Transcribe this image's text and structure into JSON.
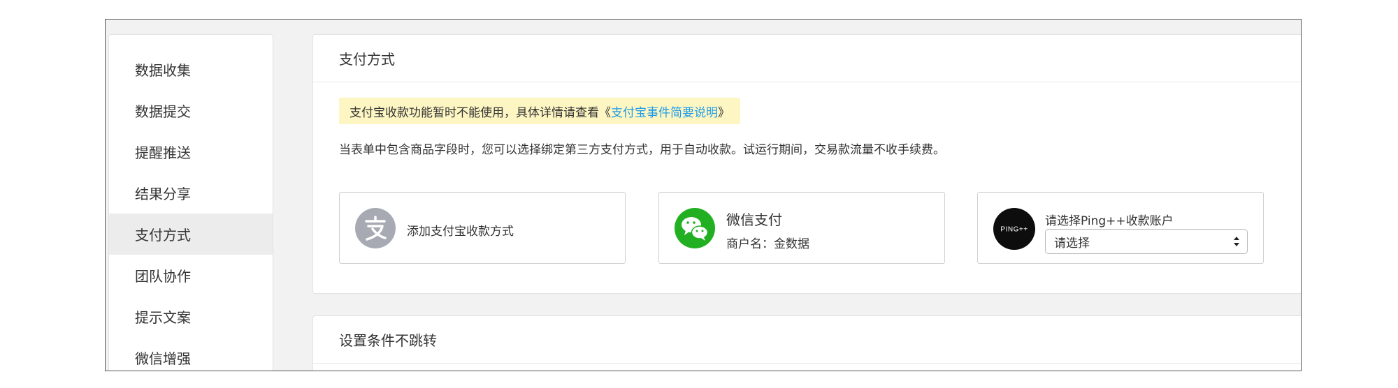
{
  "sidebar": {
    "items": [
      {
        "label": "数据收集"
      },
      {
        "label": "数据提交"
      },
      {
        "label": "提醒推送"
      },
      {
        "label": "结果分享"
      },
      {
        "label": "支付方式"
      },
      {
        "label": "团队协作"
      },
      {
        "label": "提示文案"
      },
      {
        "label": "微信增强"
      }
    ],
    "active_index": 4
  },
  "payment": {
    "title": "支付方式",
    "notice": {
      "text": "支付宝收款功能暂时不能使用，具体详情请查看《",
      "link": "支付宝事件简要说明",
      "suffix": " 》"
    },
    "description": "当表单中包含商品字段时，您可以选择绑定第三方支付方式，用于自动收款。试运行期间，交易款流量不收手续费。",
    "alipay": {
      "icon": "alipay-icon",
      "label": "添加支付宝收款方式"
    },
    "wechat": {
      "icon": "wechat-icon",
      "title": "微信支付",
      "merchant": "商户名：金数据"
    },
    "pingpp": {
      "icon_text": "PING++",
      "title": "请选择Ping++收款账户",
      "select_value": "请选择"
    }
  },
  "condition": {
    "title": "设置条件不跳转"
  },
  "colors": {
    "link": "#1e9be8",
    "notice_bg": "#fdf6c3",
    "wechat_green": "#22b022",
    "alipay_gray": "#a7aab3"
  }
}
